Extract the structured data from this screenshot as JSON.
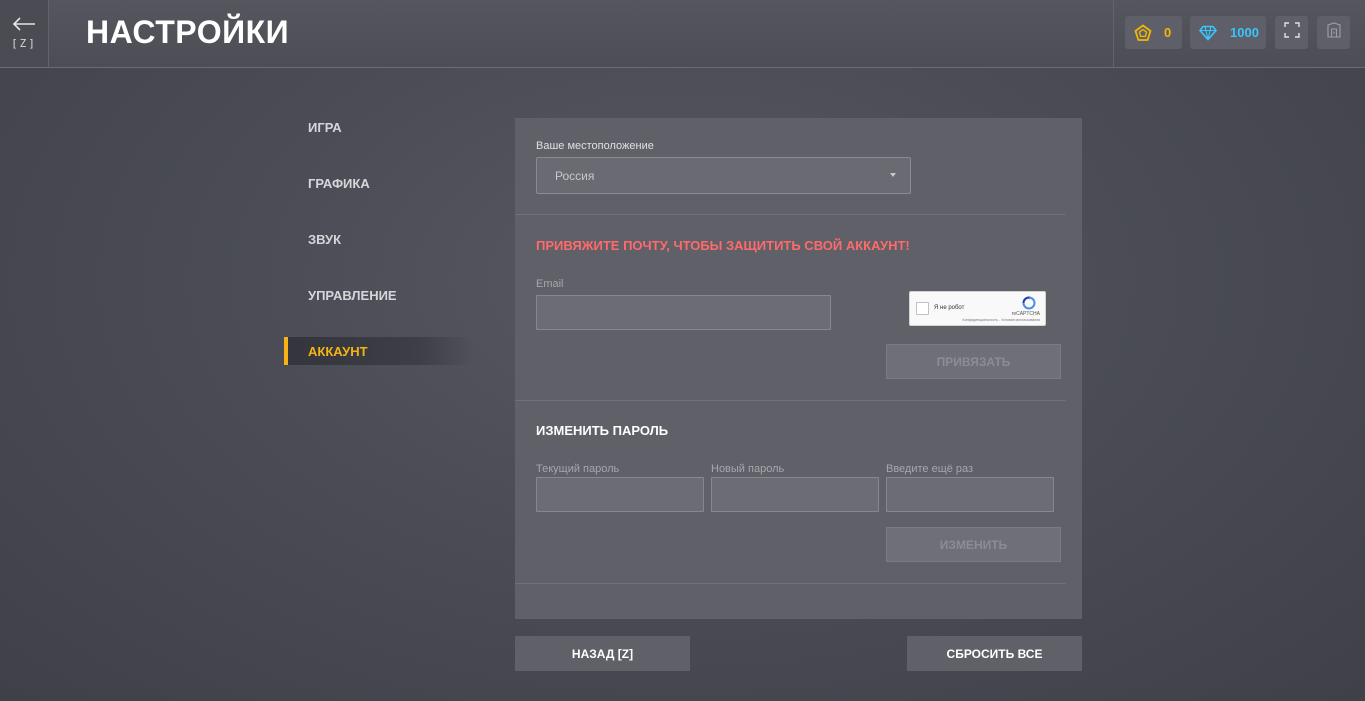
{
  "header": {
    "back_hotkey": "[Z]",
    "title": "НАСТРОЙКИ",
    "gold_value": "0",
    "gems_value": "1000",
    "gold_color": "#f2b705",
    "gem_color": "#38c6ff"
  },
  "nav": {
    "items": [
      {
        "label": "ИГРА"
      },
      {
        "label": "ГРАФИКА"
      },
      {
        "label": "ЗВУК"
      },
      {
        "label": "УПРАВЛЕНИЕ"
      },
      {
        "label": "АККАУНТ",
        "active": true
      }
    ],
    "accent_color": "#f5b316"
  },
  "account": {
    "location_label": "Ваше местоположение",
    "location_value": "Россия",
    "email_warning": "ПРИВЯЖИТЕ ПОЧТУ, ЧТОБЫ ЗАЩИТИТЬ СВОЙ АККАУНТ!",
    "email_label": "Email",
    "email_value": "",
    "captcha": {
      "label": "Я не робот",
      "brand": "reCAPTCHA",
      "links": "Конфиденциальность - Условия использования"
    },
    "bind_button": "ПРИВЯЗАТЬ",
    "password_section_title": "ИЗМЕНИТЬ ПАРОЛЬ",
    "current_password_label": "Текущий пароль",
    "new_password_label": "Новый пароль",
    "repeat_password_label": "Введите ещё раз",
    "change_button": "ИЗМЕНИТЬ",
    "warning_color": "#ff6a6a"
  },
  "footer": {
    "back_button": "НАЗАД [Z]",
    "reset_button": "СБРОСИТЬ ВСЕ"
  }
}
